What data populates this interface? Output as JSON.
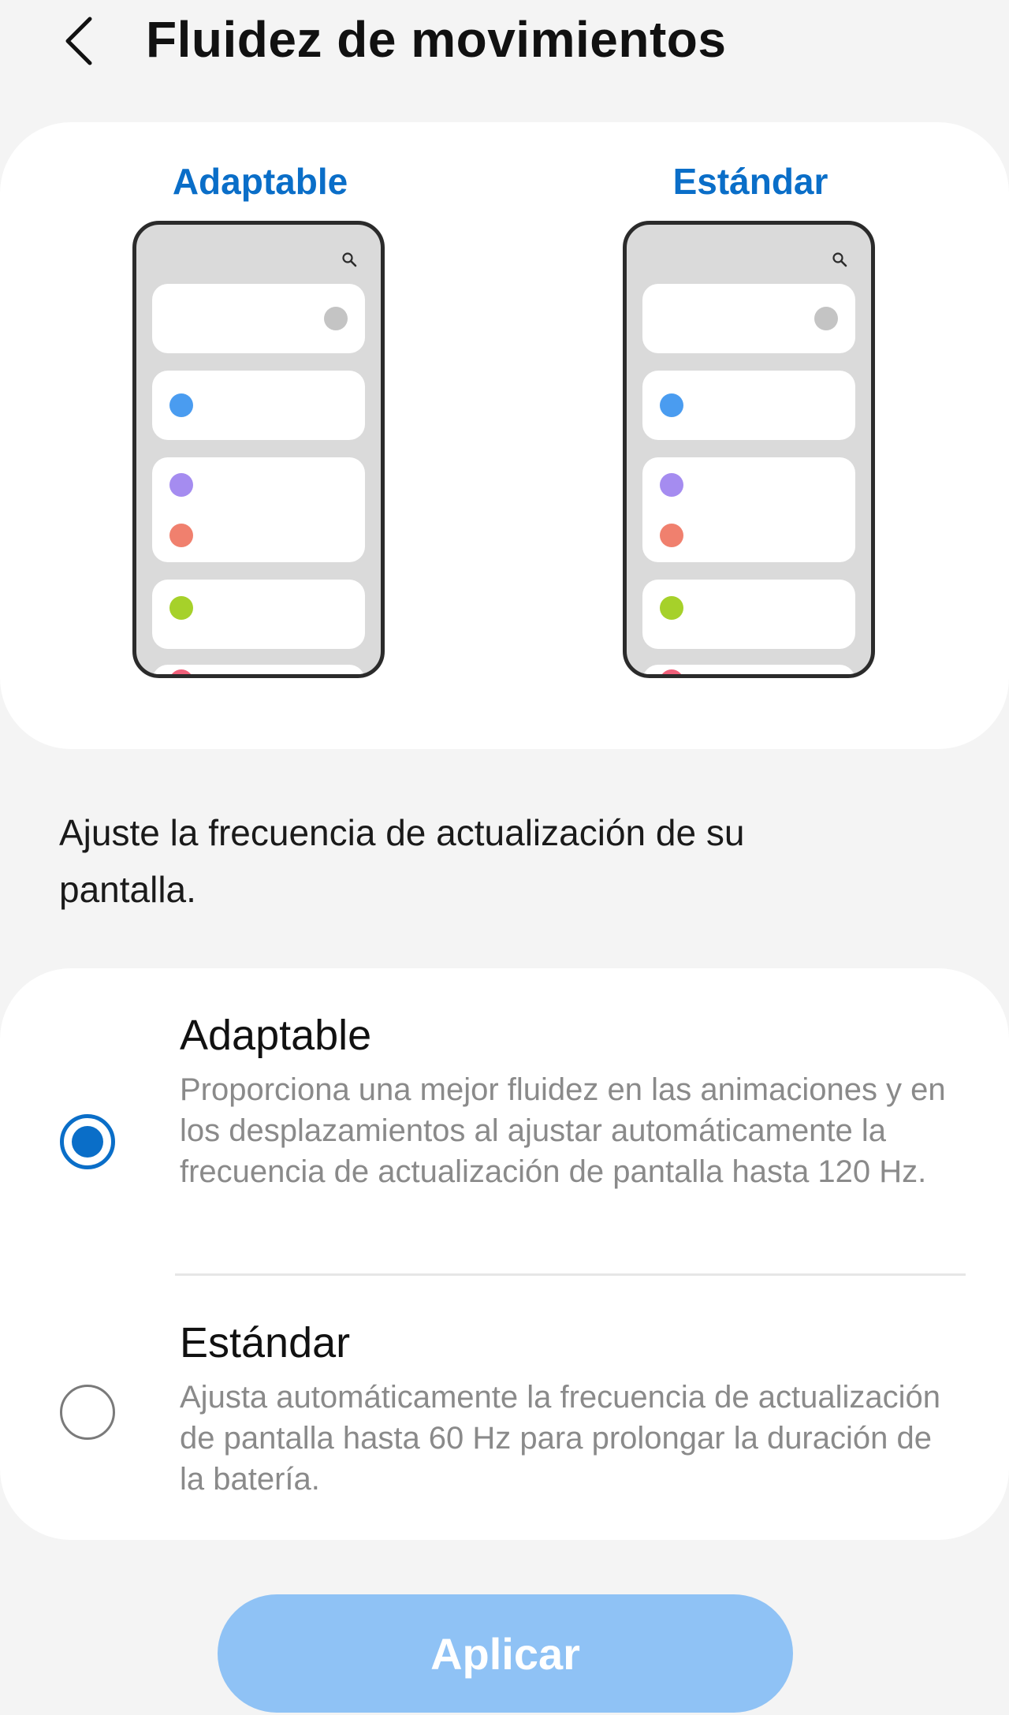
{
  "header": {
    "back_icon": "chevron-left-icon",
    "title": "Fluidez de movimientos"
  },
  "previews": [
    {
      "label": "Adaptable",
      "search_icon": "search-icon"
    },
    {
      "label": "Estándar",
      "search_icon": "search-icon"
    }
  ],
  "description": "Ajuste la frecuencia de actualización de su pantalla.",
  "options": [
    {
      "title": "Adaptable",
      "description": "Proporciona una mejor fluidez en las animaciones y en los desplazamientos al ajustar automáticamente la frecuencia de actualización de pantalla hasta 120 Hz.",
      "selected": true
    },
    {
      "title": "Estándar",
      "description": "Ajusta automáticamente la frecuencia de actualización de pantalla hasta 60 Hz para prolongar la duración de la batería.",
      "selected": false
    }
  ],
  "apply_button": "Aplicar",
  "colors": {
    "accent": "#0a6ec8",
    "button_disabled": "#8fc2f5",
    "dot_gray": "#c4c4c4",
    "dot_blue": "#4a9cf0",
    "dot_purple": "#a58cf0",
    "dot_coral": "#f0806e",
    "dot_green": "#a6d12a",
    "dot_pink": "#f0607a"
  }
}
